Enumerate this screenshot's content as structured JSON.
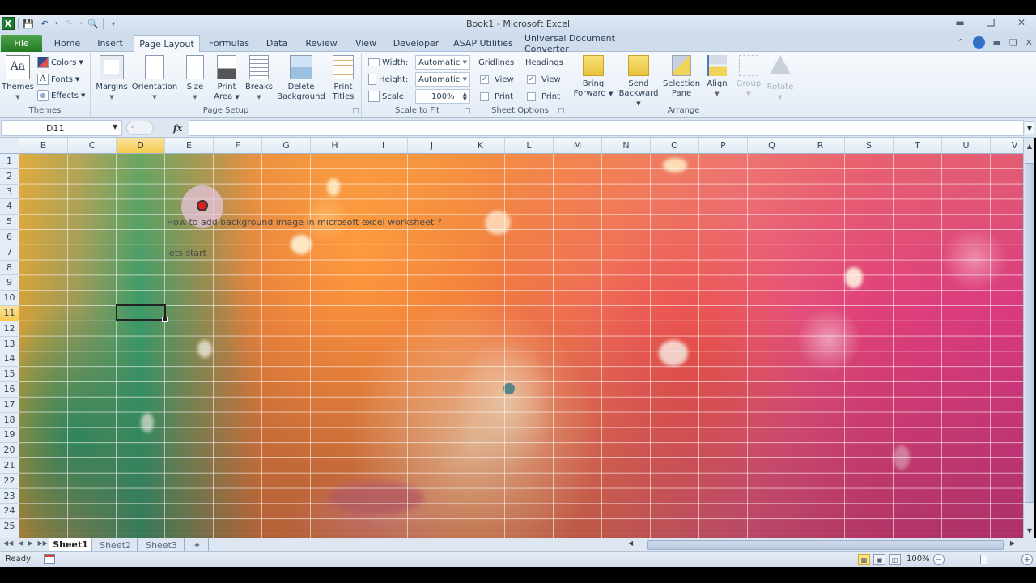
{
  "window": {
    "title": "Book1 - Microsoft Excel",
    "controls": [
      "minimize",
      "restore",
      "close"
    ]
  },
  "qat": {
    "icons": [
      "excel-logo-icon",
      "save-icon",
      "undo-icon",
      "redo-icon",
      "print-preview-icon",
      "customize-icon"
    ]
  },
  "tabs": [
    {
      "label": "File",
      "active": false
    },
    {
      "label": "Home",
      "active": false
    },
    {
      "label": "Insert",
      "active": false
    },
    {
      "label": "Page Layout",
      "active": true
    },
    {
      "label": "Formulas",
      "active": false
    },
    {
      "label": "Data",
      "active": false
    },
    {
      "label": "Review",
      "active": false
    },
    {
      "label": "View",
      "active": false
    },
    {
      "label": "Developer",
      "active": false
    },
    {
      "label": "ASAP Utilities",
      "active": false
    },
    {
      "label": "Universal Document Converter",
      "active": false
    }
  ],
  "ribbon": {
    "themes": {
      "label": "Themes",
      "themes_button": "Themes",
      "colors": "Colors",
      "fonts": "Fonts",
      "effects": "Effects"
    },
    "page_setup": {
      "label": "Page Setup",
      "margins": "Margins",
      "orientation": "Orientation",
      "size": "Size",
      "print_area_1": "Print",
      "print_area_2": "Area",
      "breaks": "Breaks",
      "delete_bg_1": "Delete",
      "delete_bg_2": "Background",
      "print_titles_1": "Print",
      "print_titles_2": "Titles"
    },
    "scale_to_fit": {
      "label": "Scale to Fit",
      "width_label": "Width:",
      "width_value": "Automatic",
      "height_label": "Height:",
      "height_value": "Automatic",
      "scale_label": "Scale:",
      "scale_value": "100%"
    },
    "sheet_options": {
      "label": "Sheet Options",
      "gridlines": "Gridlines",
      "headings": "Headings",
      "view": "View",
      "print": "Print",
      "gridlines_view": true,
      "gridlines_print": false,
      "headings_view": true,
      "headings_print": false
    },
    "arrange": {
      "label": "Arrange",
      "bring_forward_1": "Bring",
      "bring_forward_2": "Forward",
      "send_backward_1": "Send",
      "send_backward_2": "Backward",
      "selection_pane_1": "Selection",
      "selection_pane_2": "Pane",
      "align": "Align",
      "group": "Group",
      "rotate": "Rotate"
    }
  },
  "formula_bar": {
    "name_box": "D11",
    "fx": "fx",
    "formula": ""
  },
  "grid": {
    "columns": [
      "B",
      "C",
      "D",
      "E",
      "F",
      "G",
      "H",
      "I",
      "J",
      "K",
      "L",
      "M",
      "N",
      "O",
      "P",
      "Q",
      "R",
      "S",
      "T",
      "U",
      "V"
    ],
    "selected_column": "D",
    "rows": [
      "1",
      "2",
      "3",
      "4",
      "5",
      "6",
      "7",
      "8",
      "9",
      "10",
      "11",
      "12",
      "13",
      "14",
      "15",
      "16",
      "17",
      "18",
      "19",
      "20",
      "21",
      "22",
      "23",
      "24",
      "25"
    ],
    "selected_row": "11",
    "active_cell": "D11",
    "cells": {
      "E5": "How to add background image in microsoft excel worksheet ?",
      "E7": "lets start"
    }
  },
  "sheets": [
    {
      "label": "Sheet1",
      "active": true
    },
    {
      "label": "Sheet2",
      "active": false
    },
    {
      "label": "Sheet3",
      "active": false
    }
  ],
  "status": {
    "ready": "Ready",
    "zoom": "100%",
    "zoom_fraction": 0.5
  }
}
